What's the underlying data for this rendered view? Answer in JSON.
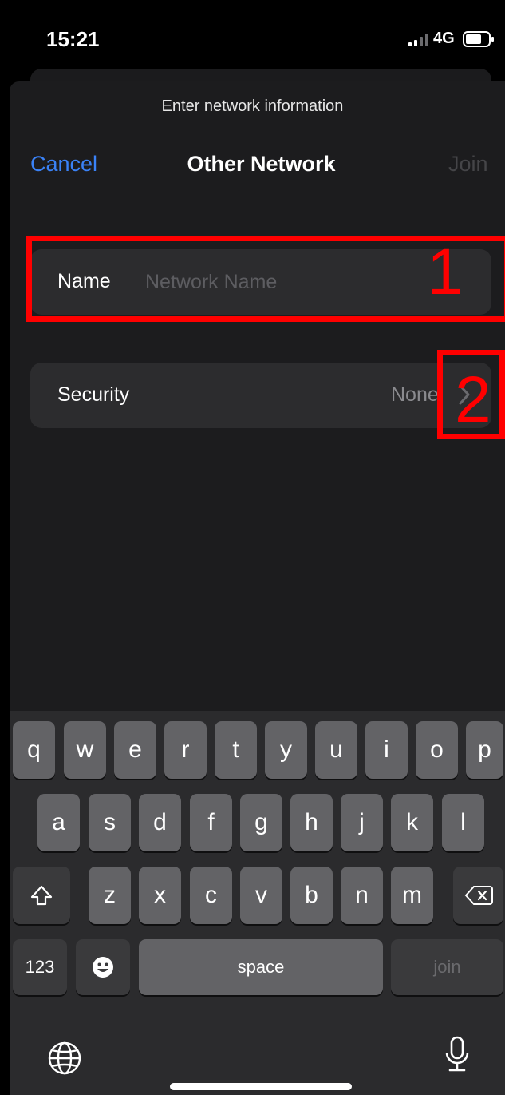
{
  "status_bar": {
    "time": "15:21",
    "network": "4G"
  },
  "sheet": {
    "subtitle": "Enter network information",
    "title": "Other Network",
    "cancel_label": "Cancel",
    "join_label": "Join"
  },
  "form": {
    "name_label": "Name",
    "name_placeholder": "Network Name",
    "name_value": "",
    "security_label": "Security",
    "security_value": "None"
  },
  "annotations": [
    "1",
    "2"
  ],
  "keyboard": {
    "row1": [
      "q",
      "w",
      "e",
      "r",
      "t",
      "y",
      "u",
      "i",
      "o",
      "p"
    ],
    "row2": [
      "a",
      "s",
      "d",
      "f",
      "g",
      "h",
      "j",
      "k",
      "l"
    ],
    "row3": [
      "z",
      "x",
      "c",
      "v",
      "b",
      "n",
      "m"
    ],
    "numbers_label": "123",
    "space_label": "space",
    "return_label": "join"
  },
  "icons": {
    "shift": "shift-icon",
    "delete": "delete-icon",
    "emoji": "emoji-icon",
    "globe": "globe-icon",
    "mic": "mic-icon",
    "chevron": "chevron-right-icon"
  },
  "colors": {
    "accent": "#3a82f7",
    "annotation": "#ff0000",
    "sheet_bg": "#1c1c1e",
    "row_bg": "#2c2c2e",
    "key_bg": "#636366",
    "keyboard_bg": "#2b2b2d"
  }
}
